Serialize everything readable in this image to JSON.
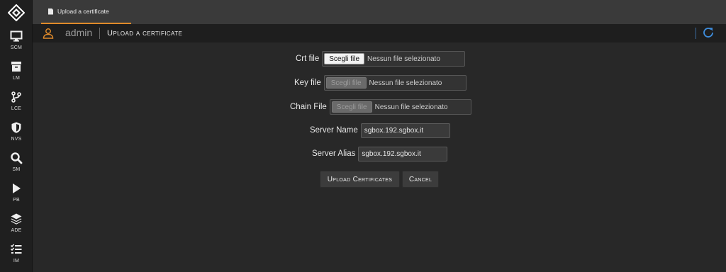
{
  "sidebar": {
    "items": [
      {
        "label": "SCM",
        "icon": "monitor-icon"
      },
      {
        "label": "LM",
        "icon": "archive-icon"
      },
      {
        "label": "LCE",
        "icon": "branch-icon"
      },
      {
        "label": "NVS",
        "icon": "shield-icon"
      },
      {
        "label": "SM",
        "icon": "search-icon"
      },
      {
        "label": "PB",
        "icon": "play-icon"
      },
      {
        "label": "ADE",
        "icon": "layers-icon"
      },
      {
        "label": "IM",
        "icon": "checklist-icon"
      }
    ]
  },
  "tabs": [
    {
      "label": "Upload a certificate"
    }
  ],
  "header": {
    "user": "admin",
    "title": "Upload a certificate"
  },
  "form": {
    "crt": {
      "label": "Crt file",
      "button": "Scegli file",
      "status": "Nessun file selezionato"
    },
    "key": {
      "label": "Key file",
      "button": "Scegli file",
      "status": "Nessun file selezionato"
    },
    "chain": {
      "label": "Chain File",
      "button": "Scegli file",
      "status": "Nessun file selezionato"
    },
    "server_name": {
      "label": "Server Name",
      "value": "sgbox.192.sgbox.it"
    },
    "server_alias": {
      "label": "Server Alias",
      "value": "sgbox.192.sgbox.it"
    },
    "upload_label": "Upload Certificates",
    "cancel_label": "Cancel"
  },
  "colors": {
    "accent": "#e08a2a",
    "refresh": "#3f8fe0"
  }
}
